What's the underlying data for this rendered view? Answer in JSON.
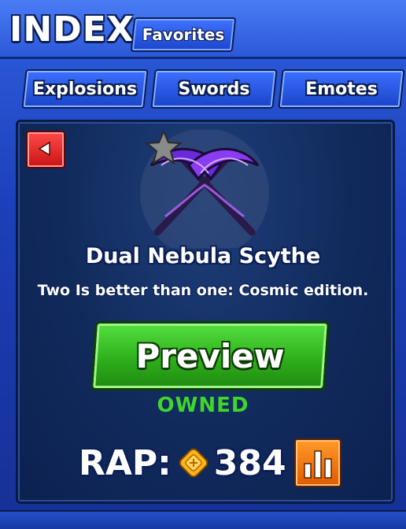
{
  "header": {
    "title": "INDEX",
    "favorites_tab": "Favorites"
  },
  "categories": [
    {
      "label": "Explosions"
    },
    {
      "label": "Swords"
    },
    {
      "label": "Emotes"
    }
  ],
  "item": {
    "name": "Dual Nebula Scythe",
    "description": "Two Is better than one: Cosmic edition.",
    "preview_label": "Preview",
    "status": "OWNED",
    "rap_label": "RAP:",
    "rap_value": "384",
    "image_icon": "dual-scythe-icon",
    "favorite_icon": "star-icon"
  },
  "colors": {
    "accent_blue": "#2c58d8",
    "preview_green": "#2fb01c",
    "owned_green": "#3fd62a",
    "back_red": "#c81414",
    "stats_orange": "#e05a00"
  }
}
